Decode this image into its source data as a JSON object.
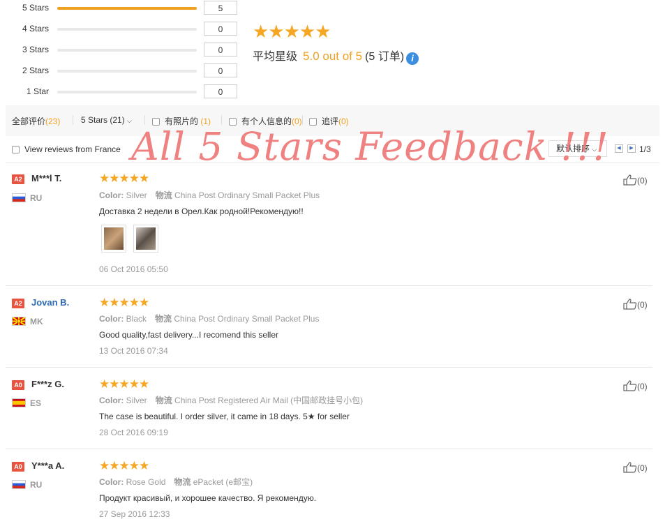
{
  "histogram": [
    {
      "label": "5 Stars",
      "count": "5",
      "fill": 1.0
    },
    {
      "label": "4 Stars",
      "count": "0",
      "fill": 0
    },
    {
      "label": "3 Stars",
      "count": "0",
      "fill": 0
    },
    {
      "label": "2 Stars",
      "count": "0",
      "fill": 0
    },
    {
      "label": "1 Star",
      "count": "0",
      "fill": 0
    }
  ],
  "summary": {
    "stars": "★★★★★",
    "avg_label": "平均星级",
    "score": "5.0 out of 5",
    "orders": "(5 订单)",
    "info_glyph": "i"
  },
  "filters": {
    "all_label": "全部评价",
    "all_count": "(23)",
    "stars_select": "5 Stars (21)",
    "photo_label": "有照片的",
    "photo_count": "(1)",
    "personal_label": "有个人信息的",
    "personal_count": "(0)",
    "followup_label": "追评",
    "followup_count": "(0)",
    "country_label": "View reviews from France"
  },
  "sort": {
    "label": "默认排序"
  },
  "pager": {
    "text": "1/3"
  },
  "overlay_text": "All 5 Stars Feedback !!!",
  "colors": {
    "accent": "#f0a020",
    "badge": "#e8543f",
    "link": "#2e6ab0",
    "overlay": "#ef7b7b"
  },
  "reviews": [
    {
      "badge": "A2",
      "name": "M***l T.",
      "country": "RU",
      "flag": "ru",
      "stars": "★★★★★",
      "color_key": "Color:",
      "color_val": "Silver",
      "ship_key": "物流",
      "ship_val": "China Post Ordinary Small Packet Plus",
      "text": "Доставка 2 недели в Орел.Как родной!Рекомендую!!",
      "date": "06 Oct 2016 05:50",
      "helpful": "(0)",
      "has_photos": true
    },
    {
      "badge": "A2",
      "name": "Jovan B.",
      "country": "MK",
      "flag": "mk",
      "stars": "★★★★★",
      "color_key": "Color:",
      "color_val": "Black",
      "ship_key": "物流",
      "ship_val": "China Post Ordinary Small Packet Plus",
      "text": "Good quality,fast delivery...I recomend this seller",
      "date": "13 Oct 2016 07:34",
      "helpful": "(0)"
    },
    {
      "badge": "A0",
      "name": "F***z G.",
      "country": "ES",
      "flag": "es",
      "stars": "★★★★★",
      "color_key": "Color:",
      "color_val": "Silver",
      "ship_key": "物流",
      "ship_val": "China Post Registered Air Mail (中国邮政挂号小包)",
      "text": "The case is beautiful. I order silver, it came in 18 days. 5★ for seller",
      "date": "28 Oct 2016 09:19",
      "helpful": "(0)"
    },
    {
      "badge": "A0",
      "name": "Y***a A.",
      "country": "RU",
      "flag": "ru",
      "stars": "★★★★★",
      "color_key": "Color:",
      "color_val": "Rose Gold",
      "ship_key": "物流",
      "ship_val": "ePacket (e邮宝)",
      "text": "Продукт красивый, и хорошее качество. Я рекомендую.",
      "date": "27 Sep 2016 12:33",
      "helpful": "(0)"
    }
  ]
}
